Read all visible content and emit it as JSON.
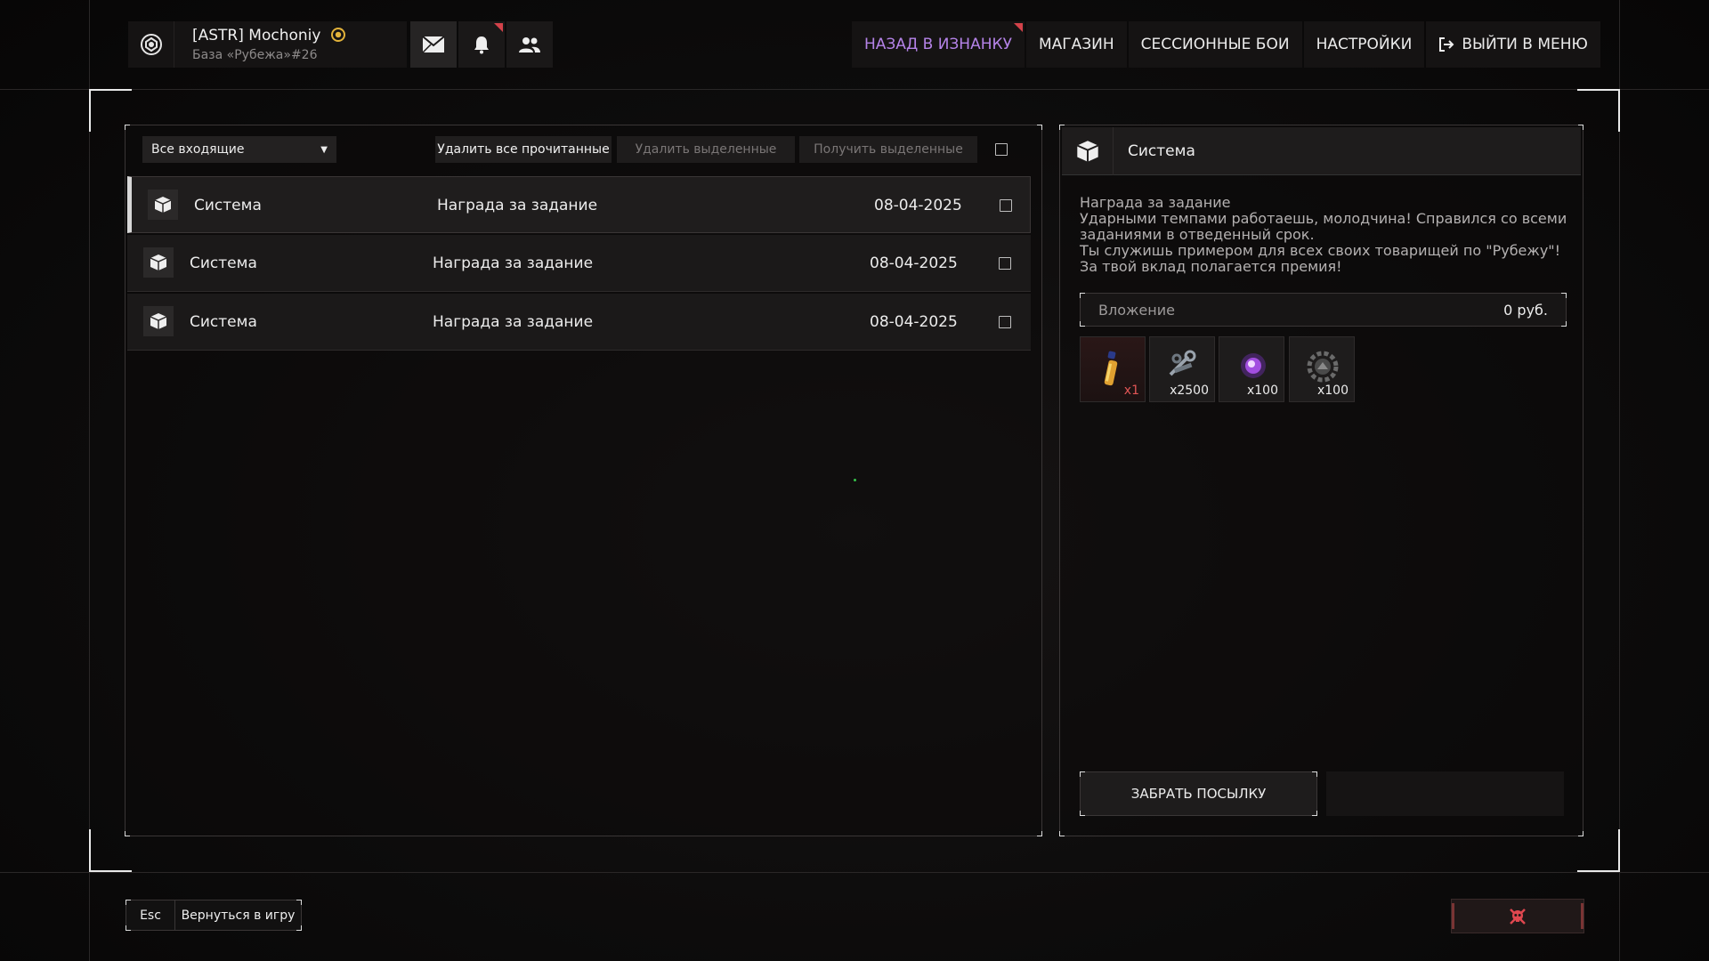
{
  "header": {
    "player_name": "[ASTR] Mochoniy",
    "player_subtitle": "База «Рубежа»#26",
    "nav": [
      {
        "label": "НАЗАД В ИЗНАНКУ"
      },
      {
        "label": "МАГАЗИН"
      },
      {
        "label": "СЕССИОННЫЕ БОИ"
      },
      {
        "label": "НАСТРОЙКИ"
      },
      {
        "label": "ВЫЙТИ В МЕНЮ"
      }
    ]
  },
  "mail": {
    "filter_selected": "Все входящие",
    "delete_read_label": "Удалить все прочитанные",
    "delete_selected_label": "Удалить выделенные",
    "claim_selected_label": "Получить выделенные",
    "messages": [
      {
        "sender": "Система",
        "subject": "Награда за задание",
        "date": "08-04-2025"
      },
      {
        "sender": "Система",
        "subject": "Награда за задание",
        "date": "08-04-2025"
      },
      {
        "sender": "Система",
        "subject": "Награда за задание",
        "date": "08-04-2025"
      }
    ]
  },
  "detail": {
    "sender": "Система",
    "body": [
      "Награда за задание",
      "Ударными темпами работаешь, молодчина! Справился со всеми",
      "заданиями в отведенный срок.",
      "Ты служишь примером для всех своих товарищей по \"Рубежу\"!",
      "За твой вклад полагается премия!"
    ],
    "attachment_label": "Вложение",
    "attachment_value": "0 руб.",
    "items": [
      {
        "icon": "fuel-canister-icon",
        "count": "x1"
      },
      {
        "icon": "scrap-parts-icon",
        "count": "x2500"
      },
      {
        "icon": "purple-energy-orb-icon",
        "count": "x100"
      },
      {
        "icon": "gear-badge-icon",
        "count": "x100"
      }
    ],
    "claim_label": "ЗАБРАТЬ ПОСЫЛКУ"
  },
  "footer": {
    "esc_key": "Esc",
    "esc_label": "Вернуться в игру"
  },
  "colors": {
    "accent": "#b583e8",
    "notification": "#d3424a",
    "report": "#e0474f"
  }
}
